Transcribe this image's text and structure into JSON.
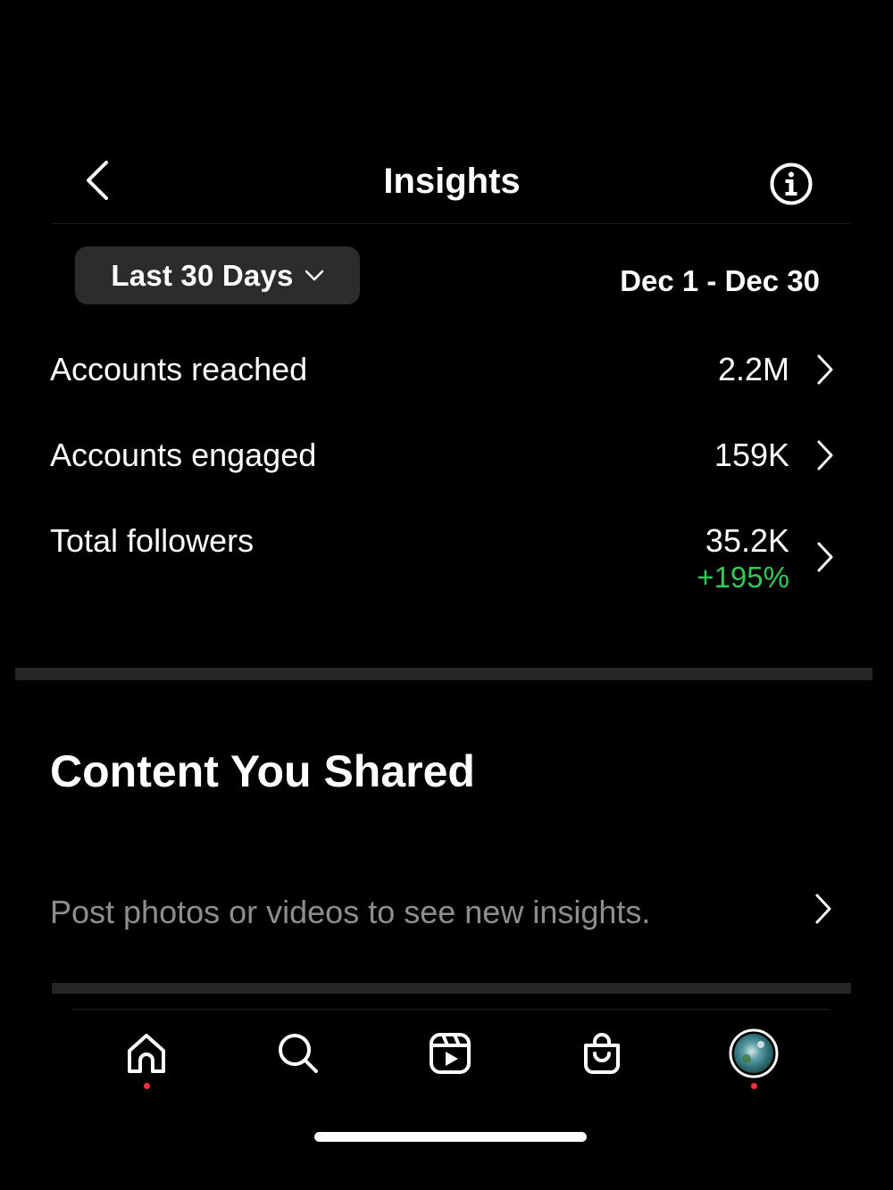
{
  "header": {
    "title": "Insights",
    "back_icon": "chevron-left-icon",
    "info_icon": "info-icon"
  },
  "range": {
    "selected": "Last 30 Days",
    "dates": "Dec 1 - Dec 30"
  },
  "metrics": [
    {
      "label": "Accounts reached",
      "value": "2.2M"
    },
    {
      "label": "Accounts engaged",
      "value": "159K"
    },
    {
      "label": "Total followers",
      "value": "35.2K",
      "change": "+195%"
    }
  ],
  "content": {
    "title": "Content You Shared",
    "empty_message": "Post photos or videos to see new insights."
  },
  "tabbar": {
    "items": [
      "home-icon",
      "search-icon",
      "reels-icon",
      "shop-icon",
      "profile-avatar"
    ]
  },
  "colors": {
    "background": "#000000",
    "pill": "#2c2c2e",
    "positive": "#34c759",
    "muted_text": "#8e8e8e",
    "notification": "#ff3040"
  }
}
